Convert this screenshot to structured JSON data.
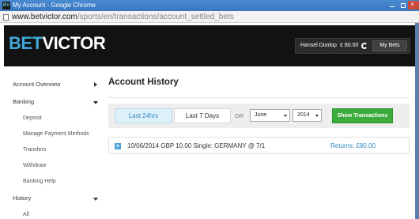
{
  "window": {
    "title": "My Account - Google Chrome",
    "app_icon": "BV"
  },
  "address": {
    "url_host": "www.betvictor.com",
    "url_path": "/sports/en/transactions/account_settled_bets"
  },
  "header": {
    "logo_bet": "BET",
    "logo_victor": "VICTOR",
    "account_name": "Hansel Dunlop",
    "balance": "£ 80.00",
    "my_bets_label": "My Bets"
  },
  "sidebar": {
    "items": [
      {
        "label": "Account Overview"
      },
      {
        "label": "Banking"
      },
      {
        "label": "Deposit"
      },
      {
        "label": "Manage Payment Methods"
      },
      {
        "label": "Transfers"
      },
      {
        "label": "Withdraw"
      },
      {
        "label": "Banking Help"
      },
      {
        "label": "History"
      },
      {
        "label": "All"
      }
    ]
  },
  "main": {
    "title": "Account History",
    "filters": {
      "last_24_label": "Last 24hrs",
      "last_7_label": "Last 7 Days",
      "or_label": "OR",
      "month_value": "June",
      "year_value": "2014",
      "show_label": "Show Transactions"
    },
    "transactions": [
      {
        "description": "10/06/2014 GBP 10.00 Single: GERMANY @ 7/1",
        "returns": "Returns: £80.00"
      }
    ]
  },
  "colors": {
    "brand_blue": "#40a9d8",
    "header_bg": "#121212",
    "action_green": "#3bac3b"
  }
}
